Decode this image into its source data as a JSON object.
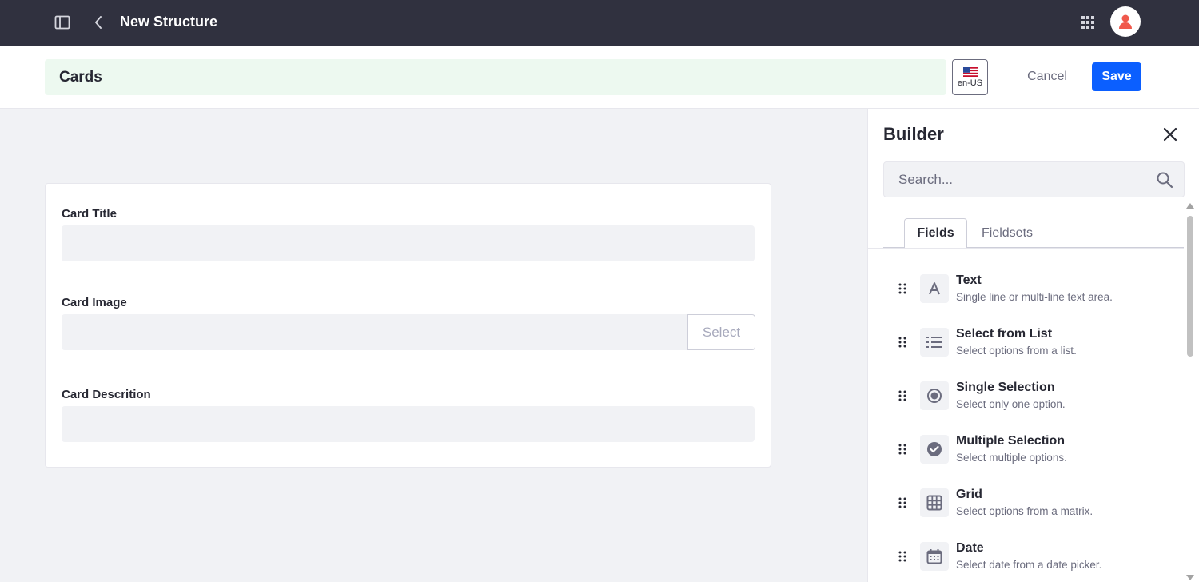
{
  "topbar": {
    "title": "New Structure",
    "sidebar_toggle_icon": "sidebar-toggle-icon",
    "back_icon": "chevron-left-icon",
    "apps_icon": "apps-grid-icon",
    "avatar_icon": "user-icon"
  },
  "header": {
    "structure_name": "Cards",
    "language": "en-US",
    "language_flag": "us-flag-icon",
    "cancel_label": "Cancel",
    "save_label": "Save"
  },
  "form": {
    "fields": [
      {
        "label": "Card Title"
      },
      {
        "label": "Card Image",
        "button": "Select"
      },
      {
        "label": "Card Descrition"
      }
    ]
  },
  "builder": {
    "title": "Builder",
    "search_placeholder": "Search...",
    "tabs": [
      {
        "label": "Fields",
        "active": true
      },
      {
        "label": "Fieldsets",
        "active": false
      }
    ],
    "field_types": [
      {
        "name": "Text",
        "description": "Single line or multi-line text area.",
        "icon": "text-icon"
      },
      {
        "name": "Select from List",
        "description": "Select options from a list.",
        "icon": "list-icon"
      },
      {
        "name": "Single Selection",
        "description": "Select only one option.",
        "icon": "radio-icon"
      },
      {
        "name": "Multiple Selection",
        "description": "Select multiple options.",
        "icon": "check-circle-icon"
      },
      {
        "name": "Grid",
        "description": "Select options from a matrix.",
        "icon": "grid-icon"
      },
      {
        "name": "Date",
        "description": "Select date from a date picker.",
        "icon": "calendar-icon"
      }
    ]
  },
  "colors": {
    "topbar": "#30313f",
    "primary": "#0b5fff",
    "name_input_bg": "#edf9f0",
    "avatar_accent": "#f0594c"
  }
}
